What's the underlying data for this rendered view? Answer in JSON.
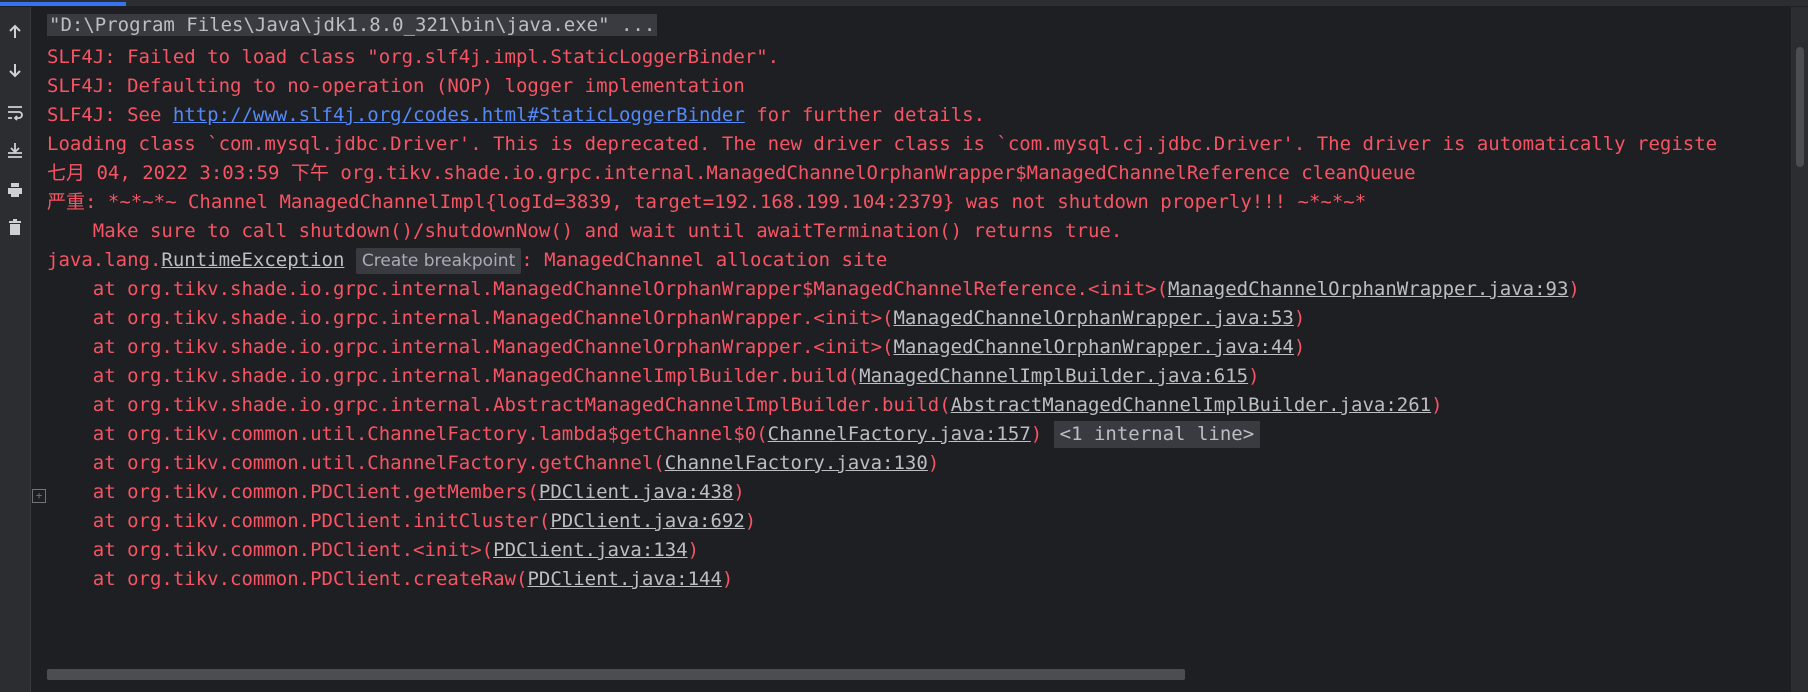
{
  "toolbar": {
    "icons": [
      "arrow-up-icon",
      "arrow-down-icon",
      "soft-wrap-icon",
      "scroll-to-end-icon",
      "print-icon",
      "trash-icon"
    ]
  },
  "console": {
    "cmd": "\"D:\\Program Files\\Java\\jdk1.8.0_321\\bin\\java.exe\" ...",
    "l1": "SLF4J: Failed to load class \"org.slf4j.impl.StaticLoggerBinder\".",
    "l2": "SLF4J: Defaulting to no-operation (NOP) logger implementation",
    "l3a": "SLF4J: See ",
    "l3link": "http://www.slf4j.org/codes.html#StaticLoggerBinder",
    "l3b": " for further details.",
    "l4": "Loading class `com.mysql.jdbc.Driver'. This is deprecated. The new driver class is `com.mysql.cj.jdbc.Driver'. The driver is automatically registe",
    "l5": "七月 04, 2022 3:03:59 下午 org.tikv.shade.io.grpc.internal.ManagedChannelOrphanWrapper$ManagedChannelReference cleanQueue",
    "l6": "严重: *~*~*~ Channel ManagedChannelImpl{logId=3839, target=192.168.199.104:2379} was not shutdown properly!!! ~*~*~*",
    "l7": "    Make sure to call shutdown()/shutdownNow() and wait until awaitTermination() returns true.",
    "l8a": "java.lang.",
    "l8ex": "RuntimeException",
    "l8badge": "Create breakpoint",
    "l8b": ": ManagedChannel allocation site",
    "s1a": "    at org.tikv.shade.io.grpc.internal.ManagedChannelOrphanWrapper$ManagedChannelReference.<init>(",
    "s1l": "ManagedChannelOrphanWrapper.java:93",
    "s2a": "    at org.tikv.shade.io.grpc.internal.ManagedChannelOrphanWrapper.<init>(",
    "s2l": "ManagedChannelOrphanWrapper.java:53",
    "s3a": "    at org.tikv.shade.io.grpc.internal.ManagedChannelOrphanWrapper.<init>(",
    "s3l": "ManagedChannelOrphanWrapper.java:44",
    "s4a": "    at org.tikv.shade.io.grpc.internal.ManagedChannelImplBuilder.build(",
    "s4l": "ManagedChannelImplBuilder.java:615",
    "s5a": "    at org.tikv.shade.io.grpc.internal.AbstractManagedChannelImplBuilder.build(",
    "s5l": "AbstractManagedChannelImplBuilder.java:261",
    "s6a": "    at org.tikv.common.util.ChannelFactory.lambda$getChannel$0(",
    "s6l": "ChannelFactory.java:157",
    "s6pill": "<1 internal line>",
    "s7a": "    at org.tikv.common.util.ChannelFactory.getChannel(",
    "s7l": "ChannelFactory.java:130",
    "s8a": "    at org.tikv.common.PDClient.getMembers(",
    "s8l": "PDClient.java:438",
    "s9a": "    at org.tikv.common.PDClient.initCluster(",
    "s9l": "PDClient.java:692",
    "s10a": "    at org.tikv.common.PDClient.<init>(",
    "s10l": "PDClient.java:134",
    "s11a": "    at org.tikv.common.PDClient.createRaw(",
    "s11l": "PDClient.java:144",
    "close": ")"
  }
}
